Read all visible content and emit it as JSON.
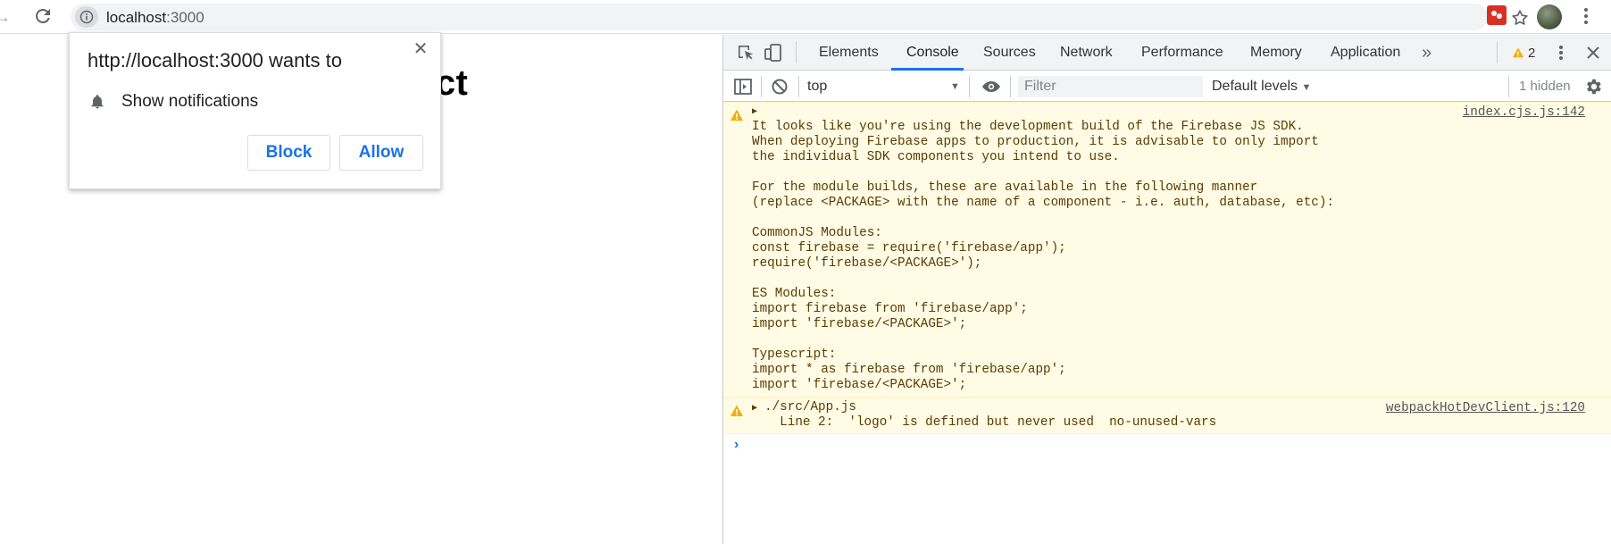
{
  "browser": {
    "url_host": "localhost",
    "url_port": ":3000"
  },
  "page": {
    "heading": "act"
  },
  "permission_prompt": {
    "title": "http://localhost:3000 wants to",
    "item": "Show notifications",
    "block_label": "Block",
    "allow_label": "Allow"
  },
  "devtools": {
    "tabs": [
      "Elements",
      "Console",
      "Sources",
      "Network",
      "Performance",
      "Memory",
      "Application"
    ],
    "active_tab": "Console",
    "more_tabs": "»",
    "warning_count": "2",
    "context": "top",
    "filter_placeholder": "Filter",
    "levels_label": "Default levels",
    "hidden_label": "1 hidden",
    "messages": [
      {
        "source": "index.cjs.js:142",
        "lines": "It looks like you're using the development build of the Firebase JS SDK.\nWhen deploying Firebase apps to production, it is advisable to only import\nthe individual SDK components you intend to use.\n\nFor the module builds, these are available in the following manner\n(replace <PACKAGE> with the name of a component - i.e. auth, database, etc):\n\nCommonJS Modules:\nconst firebase = require('firebase/app');\nrequire('firebase/<PACKAGE>');\n\nES Modules:\nimport firebase from 'firebase/app';\nimport 'firebase/<PACKAGE>';\n\nTypescript:\nimport * as firebase from 'firebase/app';\nimport 'firebase/<PACKAGE>';"
      },
      {
        "source": "webpackHotDevClient.js:120",
        "lines": "./src/App.js\n  Line 2:  'logo' is defined but never used  no-unused-vars"
      }
    ]
  },
  "colors": {
    "accent": "#1a73e8",
    "warning_bg": "#fffbe5",
    "warning_text": "#5c3c00",
    "warning_icon": "#f9ab00"
  }
}
